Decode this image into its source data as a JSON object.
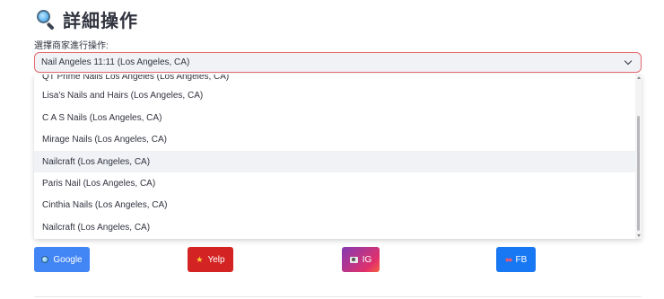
{
  "header": {
    "title": "詳細操作",
    "icon": "magnifier-icon"
  },
  "select": {
    "label": "選擇商家進行操作:",
    "value": "Nail Angeles 11:11 (Los Angeles, CA)"
  },
  "dropdown": {
    "options": [
      "QT Prime Nails Los Angeles (Los Angeles, CA)",
      "Lisa's Nails and Hairs (Los Angeles, CA)",
      "C A S Nails (Los Angeles, CA)",
      "Mirage Nails (Los Angeles, CA)",
      "Nailcraft (Los Angeles, CA)",
      "Paris Nail (Los Angeles, CA)",
      "Cinthia Nails (Los Angeles, CA)",
      "Nailcraft (Los Angeles, CA)"
    ],
    "highlighted_index": 4
  },
  "buttons": {
    "google": {
      "label": "Google",
      "icon": "magnifier-icon",
      "color": "#4285f4"
    },
    "yelp": {
      "label": "Yelp",
      "icon": "star-icon",
      "color": "#d32323"
    },
    "ig": {
      "label": "IG",
      "icon": "camera-icon",
      "color": "#c13584"
    },
    "fb": {
      "label": "FB",
      "icon": "people-icon",
      "color": "#1877f2"
    }
  },
  "colors": {
    "select_border": "#e36a6f",
    "select_bg": "#f0f2f6",
    "text": "#31333f"
  }
}
